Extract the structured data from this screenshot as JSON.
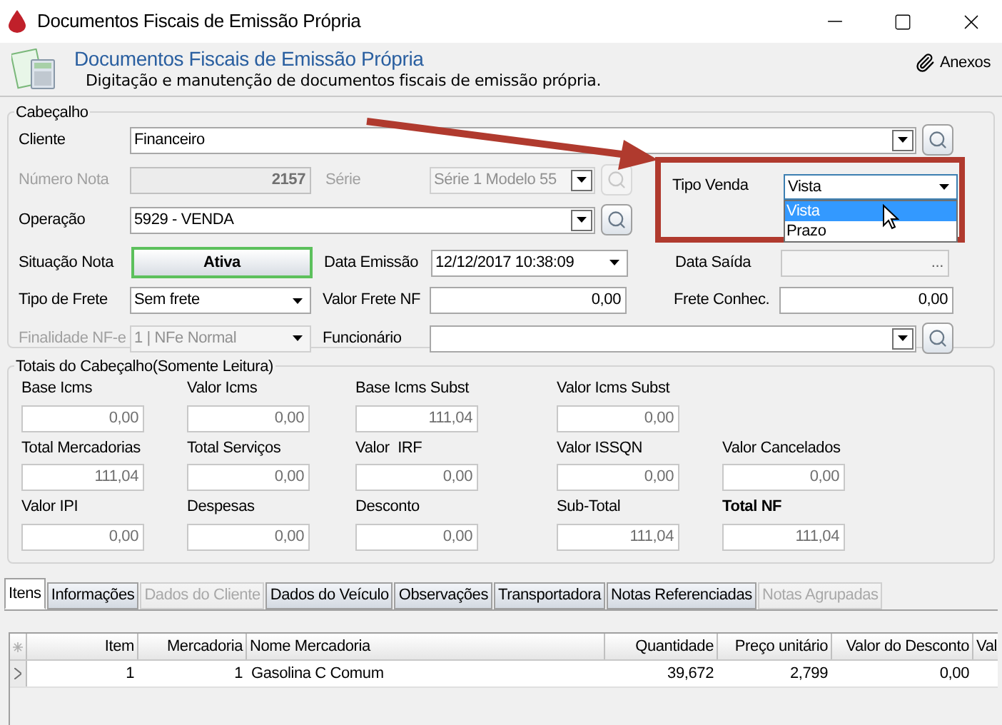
{
  "window": {
    "title": "Documentos Fiscais de Emissão Própria"
  },
  "header": {
    "title": "Documentos Fiscais de Emissão Própria",
    "subtitle": "Digitação e manutenção de documentos fiscais de emissão própria.",
    "attachments": "Anexos"
  },
  "cabecalho": {
    "legend": "Cabeçalho",
    "cliente": {
      "label": "Cliente",
      "value": "Financeiro",
      "disabled": false
    },
    "numero_nota": {
      "label": "Número Nota",
      "value": "2157",
      "disabled": true
    },
    "serie": {
      "label": "Série",
      "value": "Série 1 Modelo 55",
      "disabled": true
    },
    "tipo_venda": {
      "label": "Tipo Venda",
      "value": "Vista",
      "expanded": true,
      "options": [
        {
          "label": "Vista",
          "selected": true
        },
        {
          "label": "Prazo",
          "selected": false
        }
      ]
    },
    "operacao": {
      "label": "Operação",
      "value": "5929  - VENDA",
      "disabled": false
    },
    "situacao_nota": {
      "label": "Situação Nota",
      "button": "Ativa"
    },
    "data_emissao": {
      "label": "Data Emissão",
      "value": "12/12/2017 10:38:09"
    },
    "data_saida": {
      "label": "Data Saída",
      "button": "..."
    },
    "tipo_frete": {
      "label": "Tipo de Frete",
      "value": "Sem frete",
      "disabled": false
    },
    "valor_frete_nf": {
      "label": "Valor Frete NF",
      "value": "0,00"
    },
    "frete_conhec": {
      "label": "Frete Conhec.",
      "value": "0,00"
    },
    "finalidade_nfe": {
      "label": "Finalidade NF-e",
      "value": "1 | NFe Normal",
      "disabled": true
    },
    "funcionario": {
      "label": "Funcionário",
      "disabled": false
    }
  },
  "totais": {
    "legend": "Totais do Cabeçalho(Somente Leitura)",
    "rows": [
      [
        {
          "label": "Base Icms",
          "value": "0,00",
          "bold": false
        },
        {
          "label": "Valor Icms",
          "value": "0,00",
          "bold": false
        },
        {
          "label": "Base Icms Subst",
          "value": "111,04",
          "bold": false
        },
        {
          "label": "Valor Icms Subst",
          "value": "0,00",
          "bold": false
        }
      ],
      [
        {
          "label": "Total Mercadorias",
          "value": "111,04",
          "bold": false
        },
        {
          "label": "Total Serviços",
          "value": "0,00",
          "bold": false
        },
        {
          "label": "Valor  IRF",
          "value": "0,00",
          "bold": false
        },
        {
          "label": "Valor ISSQN",
          "value": "0,00",
          "bold": false
        },
        {
          "label": "Valor Cancelados",
          "value": "0,00",
          "bold": false
        }
      ],
      [
        {
          "label": "Valor IPI",
          "value": "0,00",
          "bold": false
        },
        {
          "label": "Despesas",
          "value": "0,00",
          "bold": false
        },
        {
          "label": "Desconto",
          "value": "0,00",
          "bold": false
        },
        {
          "label": "Sub-Total",
          "value": "111,04",
          "bold": false
        },
        {
          "label": "Total NF",
          "value": "111,04",
          "bold": true
        }
      ]
    ]
  },
  "tabs": [
    {
      "label": "Itens",
      "selected": true,
      "disabled": false
    },
    {
      "label": "Informações",
      "selected": false,
      "disabled": false
    },
    {
      "label": "Dados do Cliente",
      "selected": false,
      "disabled": true
    },
    {
      "label": "Dados do Veículo",
      "selected": false,
      "disabled": false
    },
    {
      "label": "Observações",
      "selected": false,
      "disabled": false
    },
    {
      "label": "Transportadora",
      "selected": false,
      "disabled": false
    },
    {
      "label": "Notas Referenciadas",
      "selected": false,
      "disabled": false
    },
    {
      "label": "Notas Agrupadas",
      "selected": false,
      "disabled": true
    }
  ],
  "table": {
    "columns": [
      "Item",
      "Mercadoria",
      "Nome Mercadoria",
      "Quantidade",
      "Preço unitário",
      "Valor do Desconto",
      "Val"
    ],
    "rows": [
      {
        "current": true,
        "cells": [
          "1",
          "1",
          "Gasolina C Comum",
          "39,672",
          "2,799",
          "0,00"
        ]
      }
    ]
  }
}
